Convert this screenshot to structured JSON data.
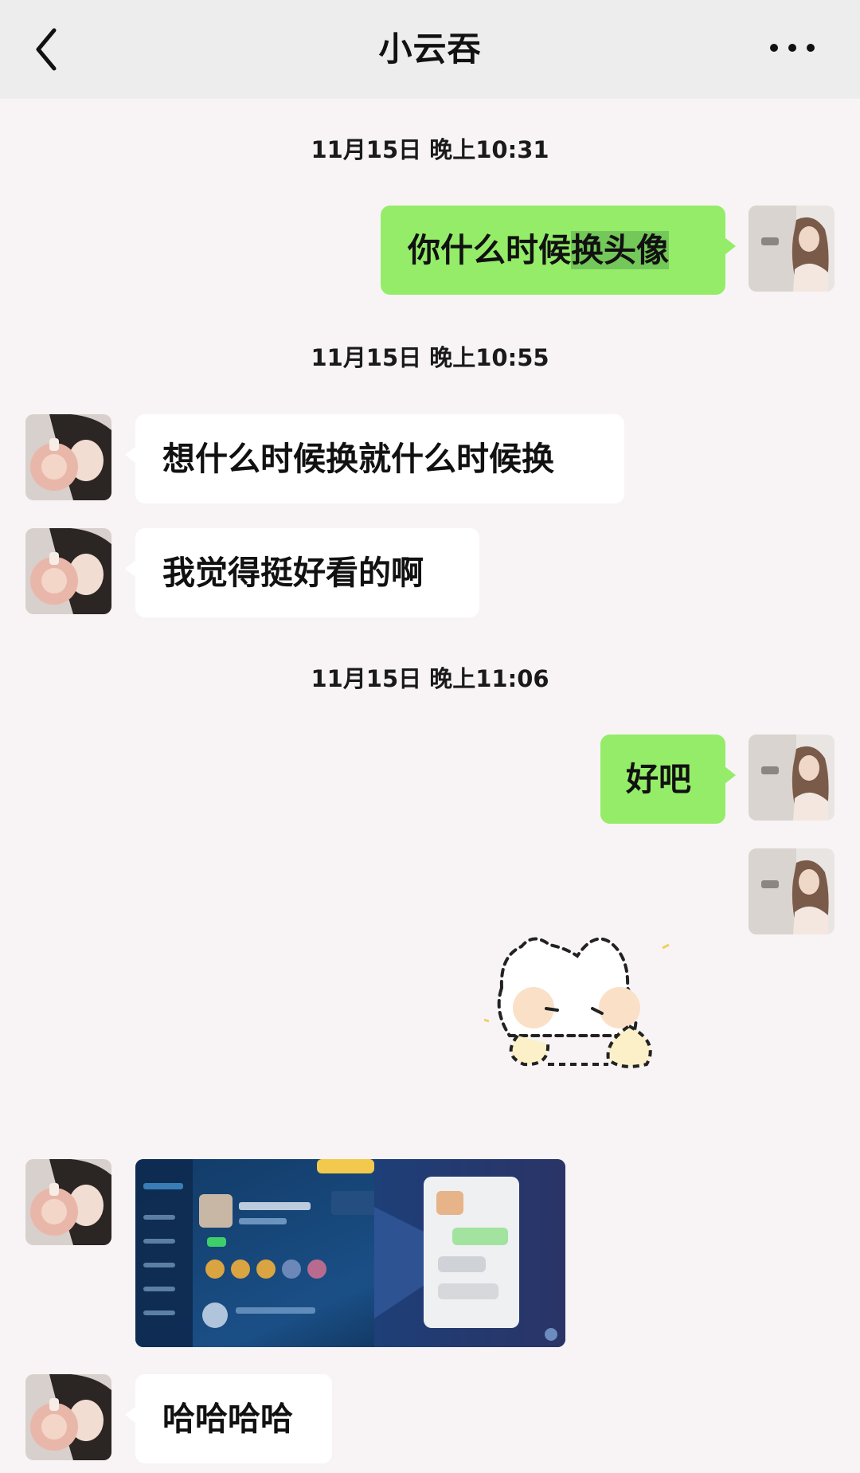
{
  "header": {
    "title": "小云吞",
    "back_icon": "chevron-left-icon",
    "more_icon": "more-dots-icon"
  },
  "messages": [
    {
      "type": "timestamp",
      "text": "11月15日 晚上10:31"
    },
    {
      "type": "text",
      "side": "out",
      "text_plain": "你什么时候",
      "text_highlight": "换头像"
    },
    {
      "type": "timestamp",
      "text": "11月15日 晚上10:55"
    },
    {
      "type": "text",
      "side": "in",
      "text": "想什么时候换就什么时候换"
    },
    {
      "type": "text",
      "side": "in",
      "text": "我觉得挺好看的啊"
    },
    {
      "type": "timestamp",
      "text": "11月15日 晚上11:06"
    },
    {
      "type": "text",
      "side": "out",
      "text": "好吧"
    },
    {
      "type": "sticker",
      "side": "out",
      "icon": "cat-sticker-icon"
    },
    {
      "type": "image",
      "side": "in",
      "icon": "game-profile-screenshot"
    },
    {
      "type": "text",
      "side": "in",
      "text": "哈哈哈哈"
    }
  ],
  "colors": {
    "outgoing": "#95ec69",
    "incoming": "#ffffff",
    "background": "#f8f4f5",
    "header": "#ededed"
  }
}
